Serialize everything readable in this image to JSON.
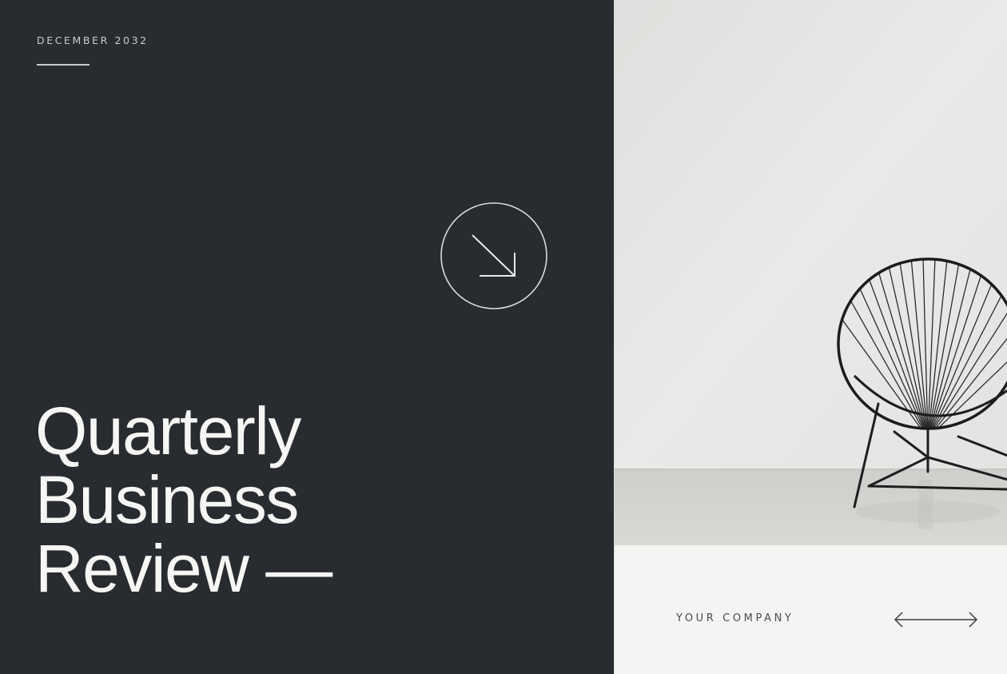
{
  "cover": {
    "date": "DECEMBER 2032",
    "title_lines": [
      "Quarterly",
      "Business",
      "Review —"
    ],
    "company": "YOUR COMPANY"
  },
  "icons": {
    "badge": "arrow-down-right-icon",
    "footer": "double-arrow-icon"
  },
  "photo": {
    "subject": "black woven acapulco chair"
  },
  "colors": {
    "dark_panel": "#282b2f",
    "light_text": "#f6f6f4",
    "muted_text": "#c9cbcd",
    "footer_bg": "#f4f5f2",
    "footer_text": "#4a4c4e"
  }
}
